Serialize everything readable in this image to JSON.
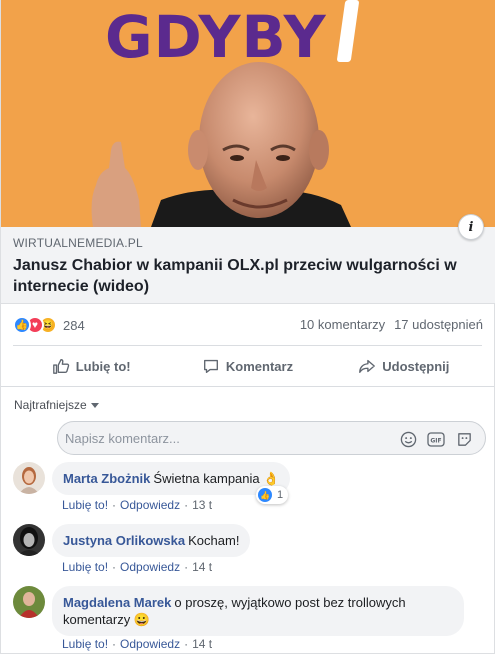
{
  "hero": {
    "overlay_text": "GDYBY",
    "info_icon": "info-icon"
  },
  "link": {
    "domain": "WIRTUALNEMEDIA.PL",
    "title": "Janusz Chabior w kampanii OLX.pl przeciw wulgarności w internecie (wideo)"
  },
  "reactions": {
    "icons": [
      "like-icon",
      "love-icon",
      "haha-icon"
    ],
    "count": "284"
  },
  "stats": {
    "comments": "10 komentarzy",
    "shares": "17 udostępnień"
  },
  "actions": {
    "like": "Lubię to!",
    "comment": "Komentarz",
    "share": "Udostępnij"
  },
  "sort": {
    "label": "Najtrafniejsze"
  },
  "composer": {
    "placeholder": "Napisz komentarz..."
  },
  "comments": [
    {
      "name": "Marta Zbożnik",
      "text": "Świetna kampania 👌",
      "like": "Lubię to!",
      "reply": "Odpowiedz",
      "time": "13 t",
      "reaction_count": "1"
    },
    {
      "name": "Justyna Orlikowska",
      "text": "Kocham!",
      "like": "Lubię to!",
      "reply": "Odpowiedz",
      "time": "14 t"
    },
    {
      "name": "Magdalena Marek",
      "text": "o proszę, wyjątkowo post bez trollowych komentarzy 😀",
      "like": "Lubię to!",
      "reply": "Odpowiedz",
      "time": "14 t"
    }
  ],
  "colors": {
    "link_blue": "#385898",
    "hero_orange": "#f2a24a",
    "hero_purple": "#5b2a8e"
  }
}
